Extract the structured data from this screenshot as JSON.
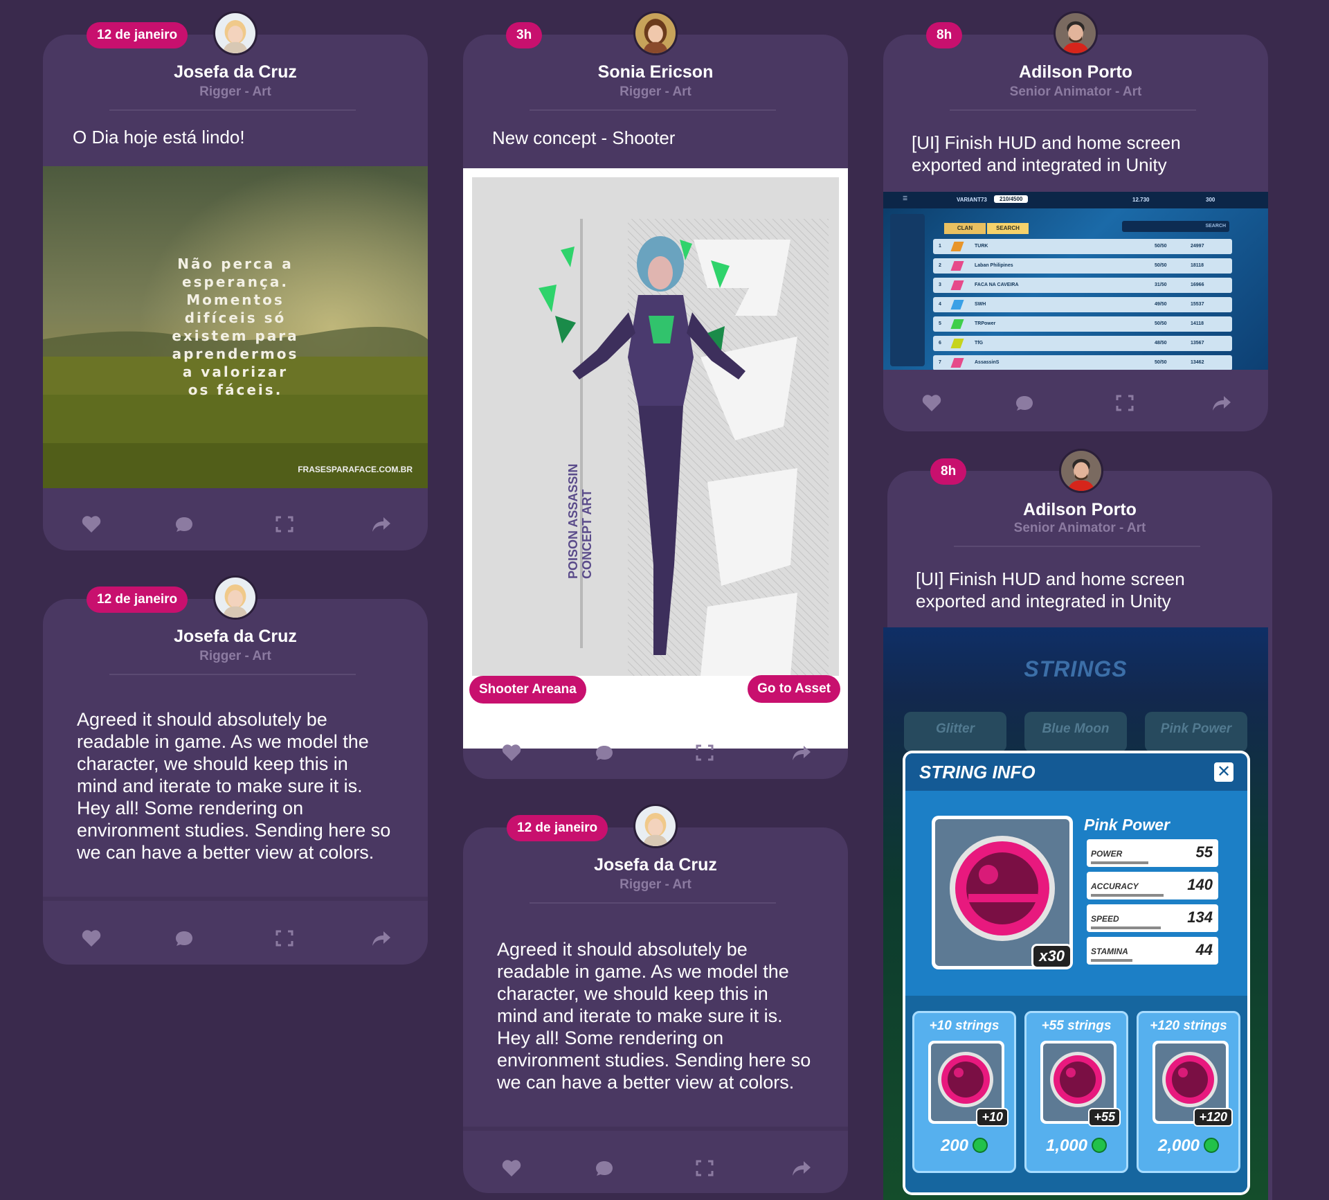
{
  "colors": {
    "background": "#3a2a4d",
    "card": "#4a3862",
    "accent": "#c8106e",
    "muted": "#8c7ba1"
  },
  "cards": [
    {
      "badge": "12 de janeiro",
      "author": "Josefa da Cruz",
      "role": "Rigger - Art",
      "text": "O Dia hoje está lindo!",
      "quote": [
        "Não perca a",
        "esperança.",
        "Momentos",
        "difíceis só",
        "existem para",
        "aprendermos",
        "a valorizar",
        "os fáceis."
      ],
      "watermark": "FRASESPARAFACE.COM.BR",
      "avatar": "woman-blonde"
    },
    {
      "badge": "12 de janeiro",
      "author": "Josefa da Cruz",
      "role": "Rigger - Art",
      "text_lines": [
        "Agreed it should absolutely be",
        "readable in game. As we model the",
        "character, we should keep this in",
        "mind and iterate to make sure it is.",
        "Hey all! Some rendering on",
        "environment studies. Sending here so",
        "we can have a better view at colors."
      ],
      "avatar": "woman-blonde"
    },
    {
      "badge": "3h",
      "author": "Sonia Ericson",
      "role": "Rigger - Art",
      "text": "New concept - Shooter",
      "poster_title": [
        "POISON ASSASSIN",
        "CONCEPT ART"
      ],
      "left_button": "Shooter Areana",
      "right_button": "Go to Asset",
      "avatar": "woman-brown"
    },
    {
      "badge": "12 de janeiro",
      "author": "Josefa da Cruz",
      "role": "Rigger - Art",
      "text_lines": [
        "Agreed it should absolutely be",
        "readable in game. As we model the",
        "character, we should keep this in",
        "mind and iterate to make sure it is.",
        "Hey all! Some rendering on",
        "environment studies. Sending here so",
        "we can have a better view at colors."
      ],
      "avatar": "woman-blonde"
    },
    {
      "badge": "8h",
      "author": "Adilson Porto",
      "role": "Senior Animator - Art",
      "text_lines": [
        "[UI] Finish HUD and home screen",
        "exported and integrated in Unity"
      ],
      "hud": {
        "player": "VARIANT73",
        "xp": "210/4500",
        "coins": "12.730",
        "gems": "300",
        "tabs": [
          "CLAN",
          "SEARCH"
        ],
        "search_label": "SEARCH",
        "rows": [
          {
            "rank": "1",
            "name": "TURK",
            "members": "50/50",
            "score": "24997"
          },
          {
            "rank": "2",
            "name": "Laban Philipines",
            "members": "50/50",
            "score": "18118"
          },
          {
            "rank": "3",
            "name": "FACA NA CAVEIRA",
            "members": "31/50",
            "score": "16966"
          },
          {
            "rank": "4",
            "name": "SWH",
            "members": "49/50",
            "score": "15537"
          },
          {
            "rank": "5",
            "name": "TRPower",
            "members": "50/50",
            "score": "14118"
          },
          {
            "rank": "6",
            "name": "TfG",
            "members": "48/50",
            "score": "13567"
          },
          {
            "rank": "7",
            "name": "AssassinS",
            "members": "50/50",
            "score": "13462"
          }
        ]
      },
      "avatar": "man-beard"
    },
    {
      "badge": "8h",
      "author": "Adilson Porto",
      "role": "Senior Animator - Art",
      "text_lines": [
        "[UI] Finish HUD and home screen",
        "exported and integrated in Unity"
      ],
      "strings": {
        "heading": "STRINGS",
        "tabs": [
          "Glitter",
          "Blue Moon",
          "Pink Power"
        ],
        "dialog_title": "STRING INFO",
        "item_name": "Pink Power",
        "count": "x30",
        "stats": [
          {
            "label": "POWER",
            "value": "55",
            "fill": 0.55
          },
          {
            "label": "ACCURACY",
            "value": "140",
            "fill": 0.7
          },
          {
            "label": "SPEED",
            "value": "134",
            "fill": 0.67
          },
          {
            "label": "STAMINA",
            "value": "44",
            "fill": 0.4
          }
        ],
        "offers": [
          {
            "title": "+10 strings",
            "badge": "+10",
            "price": "200"
          },
          {
            "title": "+55 strings",
            "badge": "+55",
            "price": "1,000"
          },
          {
            "title": "+120 strings",
            "badge": "+120",
            "price": "2,000"
          }
        ]
      },
      "avatar": "man-beard"
    }
  ],
  "icons": [
    "heart-icon",
    "comment-icon",
    "expand-icon",
    "share-icon"
  ]
}
